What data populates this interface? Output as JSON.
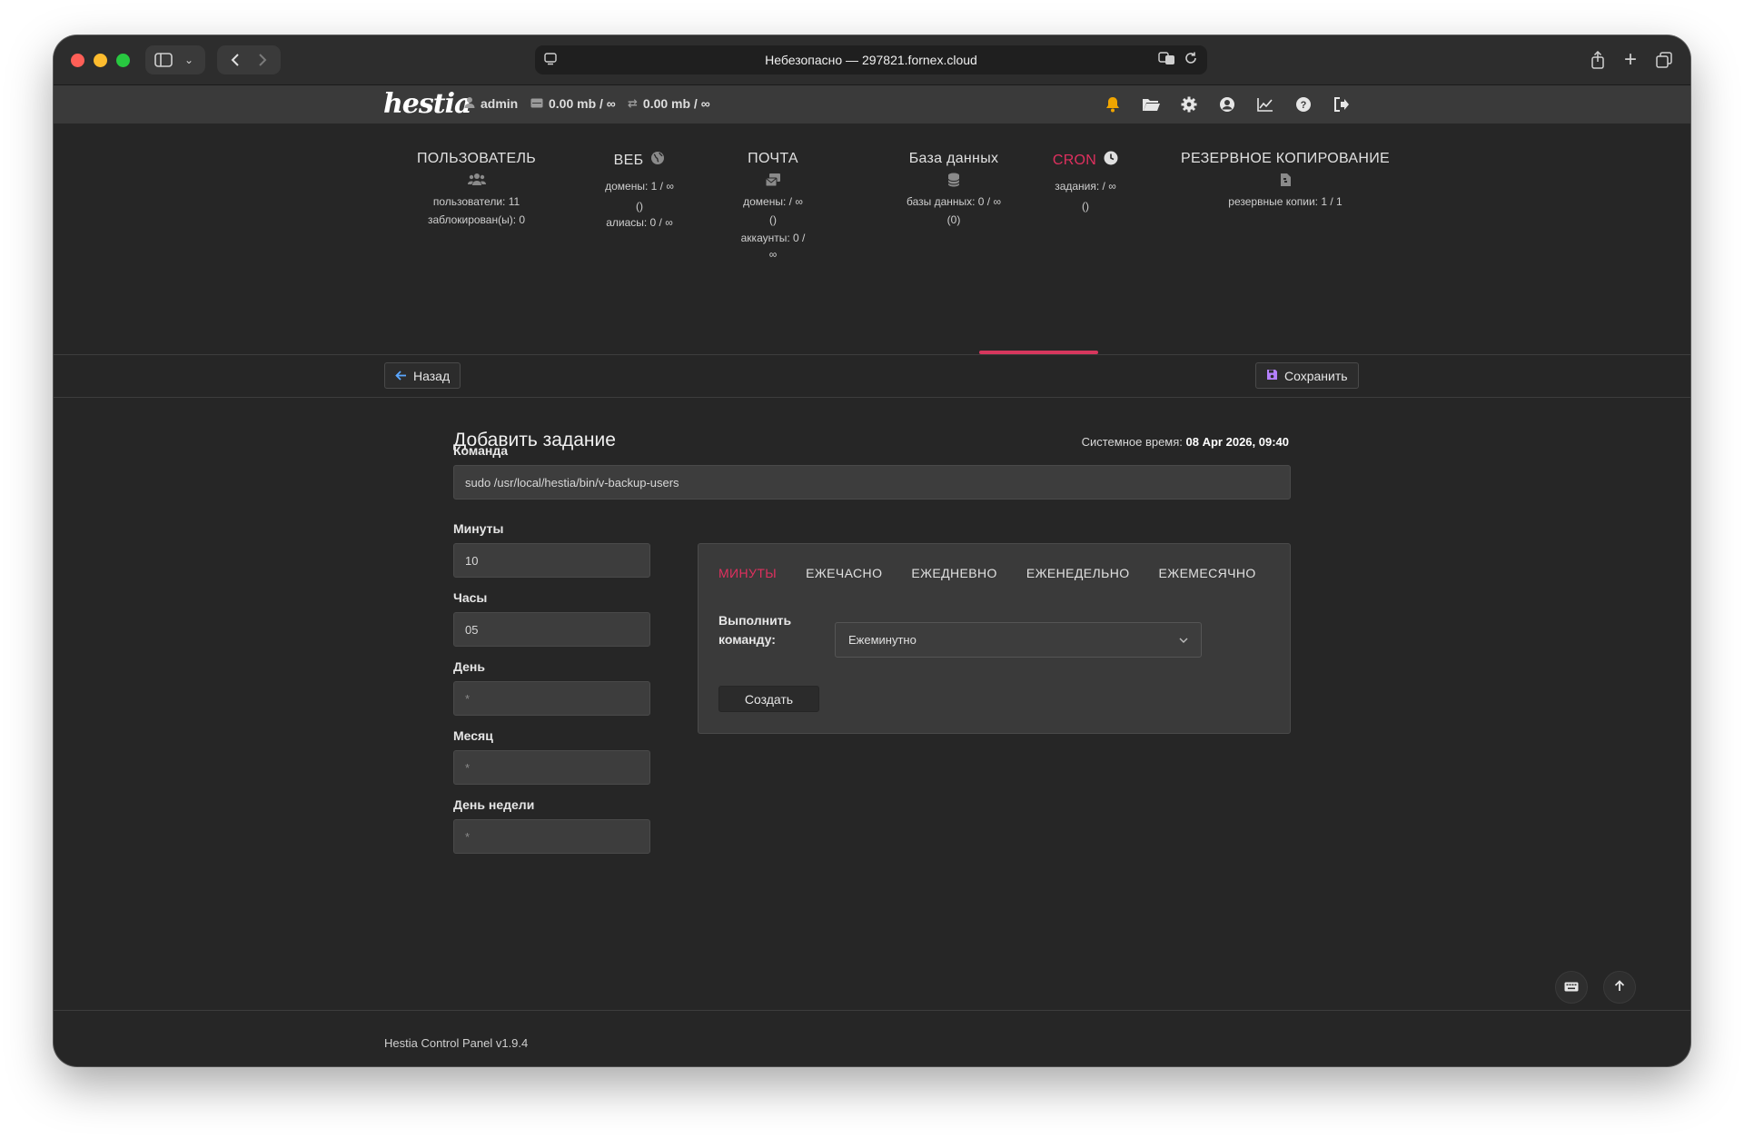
{
  "browser": {
    "address": "Небезопасно — 297821.fornex.cloud"
  },
  "topbar": {
    "logo": "hestia",
    "user": "admin",
    "disk": "0.00 mb / ∞",
    "bandwidth": "0.00 mb / ∞"
  },
  "stats": {
    "user": {
      "title": "ПОЛЬЗОВАТЕЛЬ",
      "line1": "пользователи: 11",
      "line2": "заблокирован(ы): 0"
    },
    "web": {
      "title": "ВЕБ",
      "line1": "домены: 1 / ∞",
      "line2": "()",
      "line3": "алиасы: 0 / ∞"
    },
    "mail": {
      "title": "ПОЧТА",
      "line1": "домены: / ∞",
      "line2": "()",
      "line3": "аккаунты: 0 /",
      "line4": "∞"
    },
    "db": {
      "title": "База данных",
      "line1": "базы данных: 0 / ∞",
      "line2": "(0)"
    },
    "cron": {
      "title": "CRON",
      "line1": "задания: / ∞",
      "line2": "()"
    },
    "backup": {
      "title": "РЕЗЕРВНОЕ КОПИРОВАНИЕ",
      "line1": "резервные копии: 1 / 1"
    }
  },
  "actions": {
    "back": "Назад",
    "save": "Сохранить"
  },
  "form": {
    "title": "Добавить задание",
    "systime_label": "Системное время:",
    "systime_value": "08 Apr 2026, 09:40",
    "command_label": "Команда",
    "command_value": "sudo /usr/local/hestia/bin/v-backup-users",
    "minutes_label": "Минуты",
    "minutes_value": "10",
    "hours_label": "Часы",
    "hours_value": "05",
    "day_label": "День",
    "day_value": "*",
    "month_label": "Месяц",
    "month_value": "*",
    "weekday_label": "День недели",
    "weekday_value": "*"
  },
  "cron_generator": {
    "tabs": [
      "МИНУТЫ",
      "ЕЖЕЧАСНО",
      "ЕЖЕДНЕВНО",
      "ЕЖЕНЕДЕЛЬНО",
      "ЕЖЕМЕСЯЧНО"
    ],
    "run_label_1": "Выполнить",
    "run_label_2": "команду:",
    "select_value": "Ежеминутно",
    "create": "Создать"
  },
  "footer": {
    "version": "Hestia Control Panel v1.9.4"
  },
  "colors": {
    "accent": "#e0305f",
    "bell": "#f0a500",
    "background": "#262626"
  }
}
